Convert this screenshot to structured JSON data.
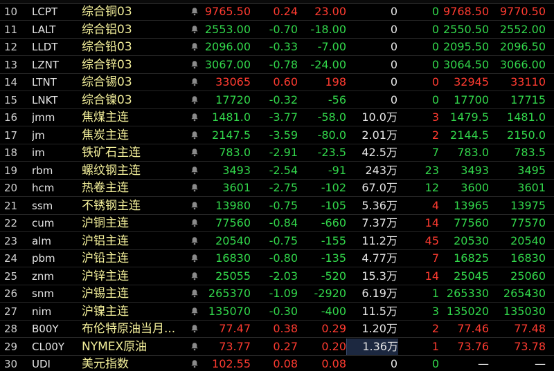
{
  "colors": {
    "up": "#ff3b30",
    "down": "#32d74b",
    "name": "#f3ef9a",
    "background": "#000000"
  },
  "rows": [
    {
      "idx": "10",
      "code": "LCPT",
      "name": "综合铜03",
      "last": "9765.50",
      "pct": "0.24",
      "chg": "23.00",
      "vol": "0",
      "qty": "0",
      "bid": "9768.50",
      "ask": "9770.50",
      "dir": "up",
      "qtydir": "down"
    },
    {
      "idx": "11",
      "code": "LALT",
      "name": "综合铝03",
      "last": "2553.00",
      "pct": "-0.70",
      "chg": "-18.00",
      "vol": "0",
      "qty": "0",
      "bid": "2550.50",
      "ask": "2552.00",
      "dir": "down",
      "qtydir": "down"
    },
    {
      "idx": "12",
      "code": "LLDT",
      "name": "综合铅03",
      "last": "2096.00",
      "pct": "-0.33",
      "chg": "-7.00",
      "vol": "0",
      "qty": "0",
      "bid": "2095.50",
      "ask": "2096.50",
      "dir": "down",
      "qtydir": "down"
    },
    {
      "idx": "13",
      "code": "LZNT",
      "name": "综合锌03",
      "last": "3067.00",
      "pct": "-0.78",
      "chg": "-24.00",
      "vol": "0",
      "qty": "0",
      "bid": "3064.50",
      "ask": "3066.00",
      "dir": "down",
      "qtydir": "down"
    },
    {
      "idx": "14",
      "code": "LTNT",
      "name": "综合锡03",
      "last": "33065",
      "pct": "0.60",
      "chg": "198",
      "vol": "0",
      "qty": "0",
      "bid": "32945",
      "ask": "33110",
      "dir": "up",
      "qtydir": "up"
    },
    {
      "idx": "15",
      "code": "LNKT",
      "name": "综合镍03",
      "last": "17720",
      "pct": "-0.32",
      "chg": "-56",
      "vol": "0",
      "qty": "0",
      "bid": "17700",
      "ask": "17715",
      "dir": "down",
      "qtydir": "down"
    },
    {
      "idx": "16",
      "code": "jmm",
      "name": "焦煤主连",
      "last": "1481.0",
      "pct": "-3.77",
      "chg": "-58.0",
      "vol": "10.0万",
      "qty": "3",
      "bid": "1479.5",
      "ask": "1481.0",
      "dir": "down",
      "qtydir": "up"
    },
    {
      "idx": "17",
      "code": "jm",
      "name": "焦炭主连",
      "last": "2147.5",
      "pct": "-3.59",
      "chg": "-80.0",
      "vol": "2.01万",
      "qty": "2",
      "bid": "2144.5",
      "ask": "2150.0",
      "dir": "down",
      "qtydir": "up"
    },
    {
      "idx": "18",
      "code": "im",
      "name": "铁矿石主连",
      "last": "783.0",
      "pct": "-2.91",
      "chg": "-23.5",
      "vol": "42.5万",
      "qty": "7",
      "bid": "783.0",
      "ask": "783.5",
      "dir": "down",
      "qtydir": "down"
    },
    {
      "idx": "19",
      "code": "rbm",
      "name": "螺纹钢主连",
      "last": "3493",
      "pct": "-2.54",
      "chg": "-91",
      "vol": "243万",
      "qty": "23",
      "bid": "3493",
      "ask": "3495",
      "dir": "down",
      "qtydir": "down"
    },
    {
      "idx": "20",
      "code": "hcm",
      "name": "热卷主连",
      "last": "3601",
      "pct": "-2.75",
      "chg": "-102",
      "vol": "67.0万",
      "qty": "12",
      "bid": "3600",
      "ask": "3601",
      "dir": "down",
      "qtydir": "down"
    },
    {
      "idx": "21",
      "code": "ssm",
      "name": "不锈钢主连",
      "last": "13980",
      "pct": "-0.75",
      "chg": "-105",
      "vol": "5.36万",
      "qty": "4",
      "bid": "13965",
      "ask": "13975",
      "dir": "down",
      "qtydir": "up"
    },
    {
      "idx": "22",
      "code": "cum",
      "name": "沪铜主连",
      "last": "77560",
      "pct": "-0.84",
      "chg": "-660",
      "vol": "7.37万",
      "qty": "14",
      "bid": "77560",
      "ask": "77570",
      "dir": "down",
      "qtydir": "up"
    },
    {
      "idx": "23",
      "code": "alm",
      "name": "沪铝主连",
      "last": "20540",
      "pct": "-0.75",
      "chg": "-155",
      "vol": "11.2万",
      "qty": "45",
      "bid": "20530",
      "ask": "20540",
      "dir": "down",
      "qtydir": "up"
    },
    {
      "idx": "24",
      "code": "pbm",
      "name": "沪铅主连",
      "last": "16830",
      "pct": "-0.80",
      "chg": "-135",
      "vol": "4.77万",
      "qty": "7",
      "bid": "16825",
      "ask": "16830",
      "dir": "down",
      "qtydir": "up"
    },
    {
      "idx": "25",
      "code": "znm",
      "name": "沪锌主连",
      "last": "25055",
      "pct": "-2.03",
      "chg": "-520",
      "vol": "15.3万",
      "qty": "14",
      "bid": "25045",
      "ask": "25060",
      "dir": "down",
      "qtydir": "up"
    },
    {
      "idx": "26",
      "code": "snm",
      "name": "沪锡主连",
      "last": "265370",
      "pct": "-1.09",
      "chg": "-2920",
      "vol": "6.19万",
      "qty": "1",
      "bid": "265330",
      "ask": "265430",
      "dir": "down",
      "qtydir": "down"
    },
    {
      "idx": "27",
      "code": "nim",
      "name": "沪镍主连",
      "last": "135070",
      "pct": "-0.30",
      "chg": "-400",
      "vol": "11.5万",
      "qty": "3",
      "bid": "135020",
      "ask": "135030",
      "dir": "down",
      "qtydir": "down"
    },
    {
      "idx": "28",
      "code": "B00Y",
      "name": "布伦特原油当月...",
      "last": "77.47",
      "pct": "0.38",
      "chg": "0.29",
      "vol": "1.20万",
      "qty": "2",
      "bid": "77.46",
      "ask": "77.48",
      "dir": "up",
      "qtydir": "up"
    },
    {
      "idx": "29",
      "code": "CL00Y",
      "name": "NYMEX原油",
      "last": "73.77",
      "pct": "0.27",
      "chg": "0.20",
      "vol": "1.36万",
      "qty": "1",
      "bid": "73.76",
      "ask": "73.78",
      "dir": "up",
      "qtydir": "up",
      "selected": true
    },
    {
      "idx": "30",
      "code": "UDI",
      "name": "美元指数",
      "last": "102.55",
      "pct": "0.08",
      "chg": "0.08",
      "vol": "0",
      "qty": "0",
      "bid": "—",
      "ask": "—",
      "dir": "up",
      "qtydir": "down"
    }
  ],
  "icons": {
    "bell": "bell-icon"
  }
}
